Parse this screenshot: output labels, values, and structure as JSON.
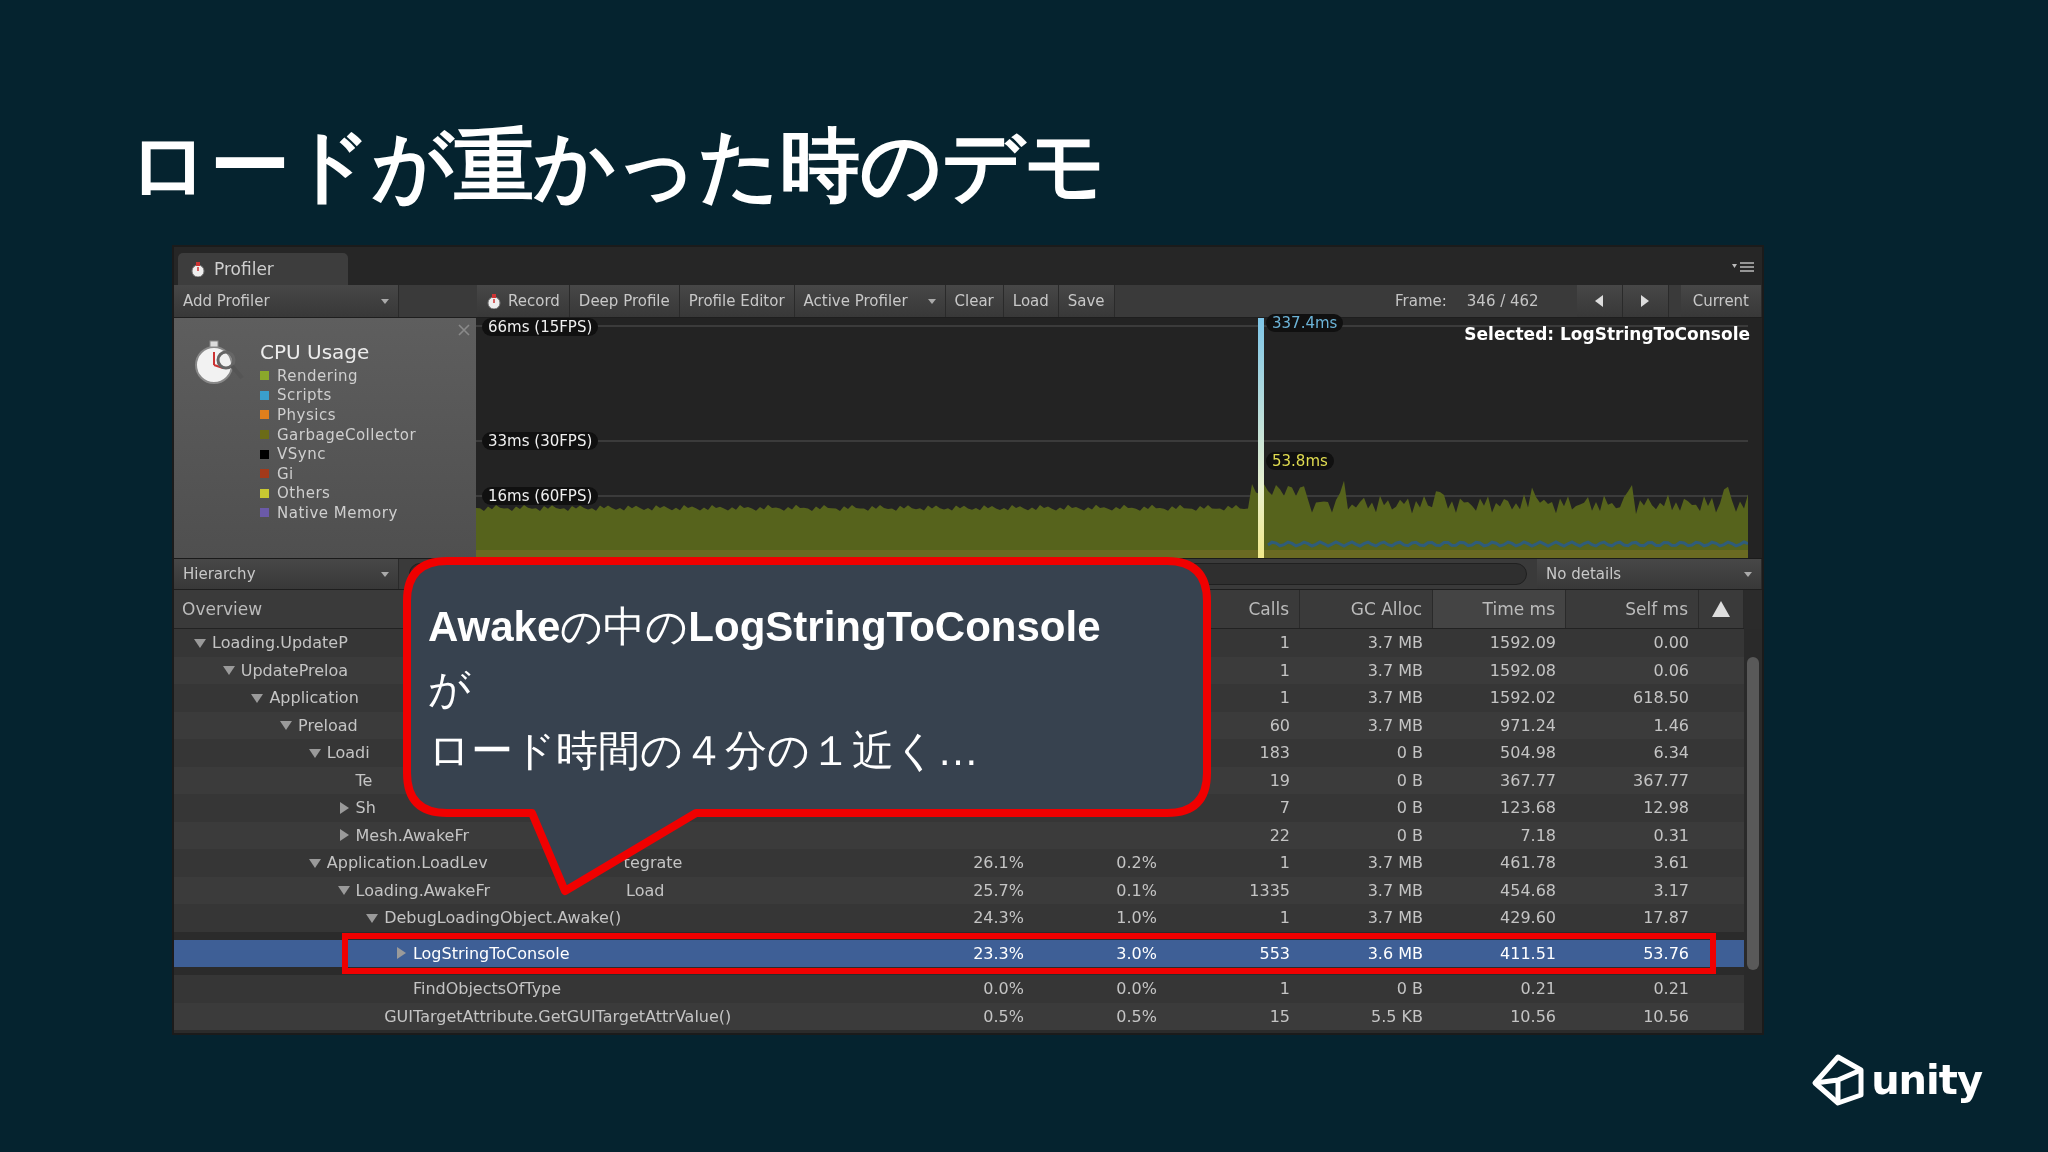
{
  "slide_title": "ロードが重かった時のデモ",
  "profiler": {
    "tab": "Profiler",
    "toolbar": {
      "add_profiler": "Add Profiler",
      "buttons": [
        {
          "label": "Record",
          "kind": "record"
        },
        {
          "label": "Deep Profile",
          "kind": "plain"
        },
        {
          "label": "Profile Editor",
          "kind": "plain"
        },
        {
          "label": "Active Profiler",
          "kind": "dropdown"
        },
        {
          "label": "Clear",
          "kind": "plain"
        },
        {
          "label": "Load",
          "kind": "plain"
        },
        {
          "label": "Save",
          "kind": "plain"
        }
      ],
      "frame_label": "Frame:",
      "frame_value": "346 / 462",
      "current": "Current"
    },
    "cpu_panel": {
      "title": "CPU Usage",
      "legend": [
        {
          "label": "Rendering",
          "color": "#8aa82b"
        },
        {
          "label": "Scripts",
          "color": "#3a9fcc"
        },
        {
          "label": "Physics",
          "color": "#e07f1c"
        },
        {
          "label": "GarbageCollector",
          "color": "#6b6b17"
        },
        {
          "label": "VSync",
          "color": "#000000"
        },
        {
          "label": "Gi",
          "color": "#a33a1a"
        },
        {
          "label": "Others",
          "color": "#c8c832"
        },
        {
          "label": "Native Memory",
          "color": "#6b5aa8"
        }
      ]
    },
    "chart": {
      "thresholds": [
        "66ms (15FPS)",
        "33ms (30FPS)",
        "16ms (60FPS)"
      ],
      "selected_total": "337.4ms",
      "selected_self": "53.8ms",
      "selected_label": "Selected: LogStringToConsole"
    },
    "hierarchy": {
      "view": "Hierarchy",
      "details": "No details",
      "columns": [
        "Overview",
        "Calls",
        "GC Alloc",
        "Time ms",
        "Self ms"
      ],
      "rows": [
        {
          "name": "Loading.UpdateP",
          "expanded": true,
          "selected": false,
          "framed": false,
          "calls": "1",
          "gc_alloc": "3.7 MB",
          "time_ms": "1592.09",
          "self_ms": "0.00",
          "children": [
            {
              "name": "UpdatePreloa",
              "expanded": true,
              "selected": false,
              "framed": false,
              "calls": "1",
              "gc_alloc": "3.7 MB",
              "time_ms": "1592.08",
              "self_ms": "0.06",
              "children": [
                {
                  "name": "Application",
                  "expanded": true,
                  "selected": false,
                  "framed": false,
                  "calls": "1",
                  "gc_alloc": "3.7 MB",
                  "time_ms": "1592.02",
                  "self_ms": "618.50",
                  "children": [
                    {
                      "name": "Preload",
                      "expanded": true,
                      "selected": false,
                      "framed": false,
                      "calls": "60",
                      "gc_alloc": "3.7 MB",
                      "time_ms": "971.24",
                      "self_ms": "1.46",
                      "children": [
                        {
                          "name": "Loadi",
                          "expanded": true,
                          "selected": false,
                          "framed": false,
                          "calls": "183",
                          "gc_alloc": "0 B",
                          "time_ms": "504.98",
                          "self_ms": "6.34",
                          "children": [
                            {
                              "name": "Te",
                              "selected": false,
                              "framed": false,
                              "calls": "19",
                              "gc_alloc": "0 B",
                              "time_ms": "367.77",
                              "self_ms": "367.77"
                            },
                            {
                              "name": "Sh",
                              "expanded": false,
                              "selected": false,
                              "framed": false,
                              "calls": "7",
                              "gc_alloc": "0 B",
                              "time_ms": "123.68",
                              "self_ms": "12.98"
                            },
                            {
                              "name": "Mesh.AwakeFr",
                              "expanded": false,
                              "selected": false,
                              "framed": false,
                              "calls": "22",
                              "gc_alloc": "0 B",
                              "time_ms": "7.18",
                              "self_ms": "0.31"
                            }
                          ]
                        },
                        {
                          "name": "Application.LoadLev",
                          "name_after": "tegrate",
                          "expanded": true,
                          "selected": false,
                          "framed": false,
                          "total": "26.1%",
                          "self": "0.2%",
                          "calls": "1",
                          "gc_alloc": "3.7 MB",
                          "time_ms": "461.78",
                          "self_ms": "3.61",
                          "children": [
                            {
                              "name": "Loading.AwakeFr",
                              "name_after": "Load",
                              "expanded": true,
                              "selected": false,
                              "framed": false,
                              "total": "25.7%",
                              "self": "0.1%",
                              "calls": "1335",
                              "gc_alloc": "3.7 MB",
                              "time_ms": "454.68",
                              "self_ms": "3.17",
                              "children": [
                                {
                                  "name": "DebugLoadingObject.Awake()",
                                  "expanded": true,
                                  "selected": false,
                                  "framed": false,
                                  "total": "24.3%",
                                  "self": "1.0%",
                                  "calls": "1",
                                  "gc_alloc": "3.7 MB",
                                  "time_ms": "429.60",
                                  "self_ms": "17.87",
                                  "children": [
                                    {
                                      "name": "LogStringToConsole",
                                      "expanded": false,
                                      "selected": true,
                                      "framed": true,
                                      "total": "23.3%",
                                      "self": "3.0%",
                                      "calls": "553",
                                      "gc_alloc": "3.6 MB",
                                      "time_ms": "411.51",
                                      "self_ms": "53.76"
                                    },
                                    {
                                      "name": "FindObjectsOfType",
                                      "selected": false,
                                      "framed": false,
                                      "total": "0.0%",
                                      "self": "0.0%",
                                      "calls": "1",
                                      "gc_alloc": "0 B",
                                      "time_ms": "0.21",
                                      "self_ms": "0.21"
                                    }
                                  ]
                                },
                                {
                                  "name": "GUITargetAttribute.GetGUITargetAttrValue()",
                                  "selected": false,
                                  "framed": false,
                                  "total": "0.5%",
                                  "self": "0.5%",
                                  "calls": "15",
                                  "gc_alloc": "5.5 KB",
                                  "time_ms": "10.56",
                                  "self_ms": "10.56"
                                }
                              ]
                            }
                          ]
                        }
                      ]
                    }
                  ]
                }
              ]
            }
          ]
        }
      ]
    }
  },
  "callout": {
    "lines": [
      "**Awake**の中の**LogStringToConsole**",
      "が",
      "ロード時間の４分の１近く…"
    ]
  },
  "logo": "unity"
}
